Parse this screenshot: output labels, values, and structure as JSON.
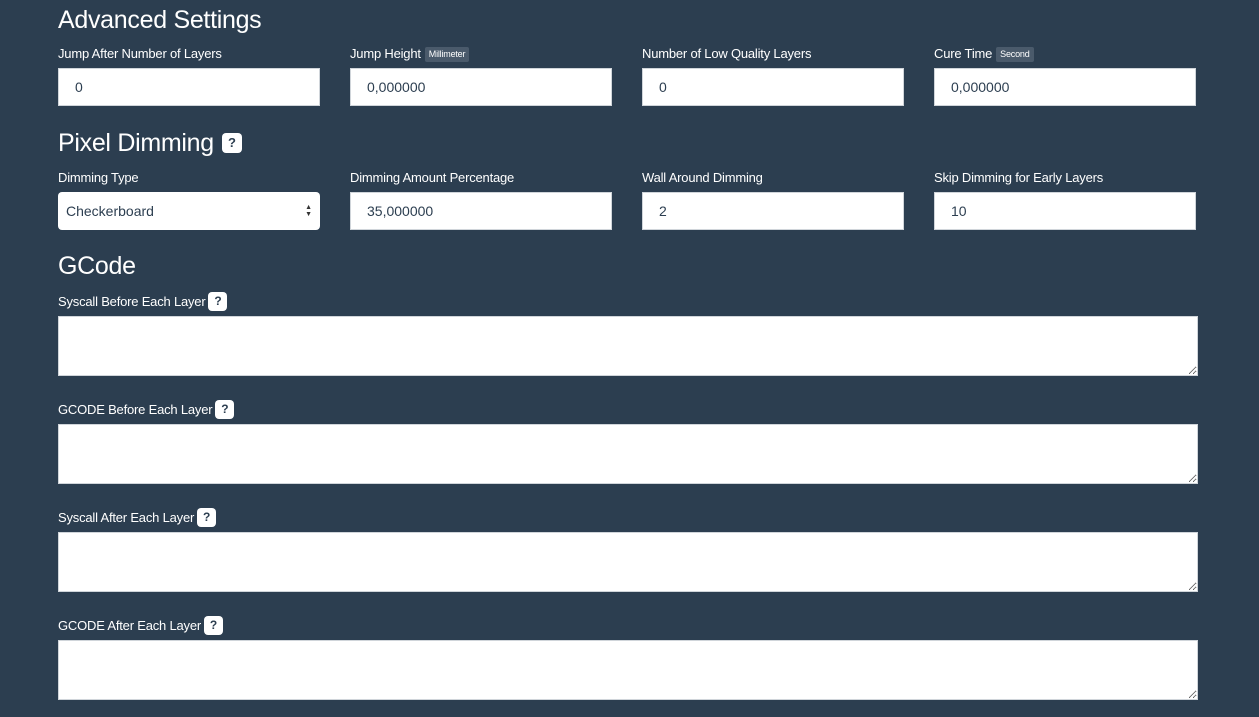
{
  "advanced": {
    "title": "Advanced Settings",
    "fields": [
      {
        "label": "Jump After Number of Layers",
        "unit": "",
        "value": "0"
      },
      {
        "label": "Jump Height",
        "unit": "Millimeter",
        "value": "0,000000"
      },
      {
        "label": "Number of Low Quality Layers",
        "unit": "",
        "value": "0"
      },
      {
        "label": "Cure Time",
        "unit": "Second",
        "value": "0,000000"
      }
    ]
  },
  "dimming": {
    "title": "Pixel Dimming",
    "help_icon": "question-icon",
    "help_label": "?",
    "type": {
      "label": "Dimming Type",
      "value": "Checkerboard"
    },
    "fields": [
      {
        "label": "Dimming Amount Percentage",
        "value": "35,000000"
      },
      {
        "label": "Wall Around Dimming",
        "value": "2"
      },
      {
        "label": "Skip Dimming for Early Layers",
        "value": "10"
      }
    ]
  },
  "gcode": {
    "title": "GCode",
    "help_label": "?",
    "fields": [
      {
        "label": "Syscall Before Each Layer",
        "value": ""
      },
      {
        "label": "GCODE Before Each Layer",
        "value": ""
      },
      {
        "label": "Syscall After Each Layer",
        "value": ""
      },
      {
        "label": "GCODE After Each Layer",
        "value": ""
      }
    ]
  },
  "colors": {
    "background": "#2c3e50",
    "input_bg": "#ffffff",
    "badge_bg": "#4a5a6b",
    "text": "#ffffff"
  }
}
